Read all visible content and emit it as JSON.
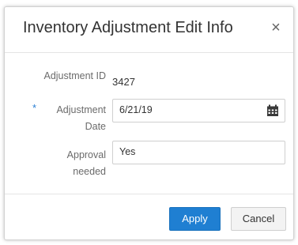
{
  "dialog": {
    "title": "Inventory Adjustment Edit Info",
    "close_symbol": "×",
    "icons": {
      "close": "close-icon",
      "calendar": "calendar-icon"
    }
  },
  "fields": {
    "adjustment_id": {
      "label": "Adjustment ID",
      "value": "3427"
    },
    "adjustment_date": {
      "required_marker": "*",
      "label_line1": "Adjustment",
      "label_line2": "Date",
      "value": "6/21/19"
    },
    "approval_needed": {
      "label_line1": "Approval",
      "label_line2": "needed",
      "value": "Yes"
    }
  },
  "footer": {
    "apply_label": "Apply",
    "cancel_label": "Cancel"
  },
  "colors": {
    "primary": "#1f7fd2",
    "required_star": "#2a7fd4"
  }
}
